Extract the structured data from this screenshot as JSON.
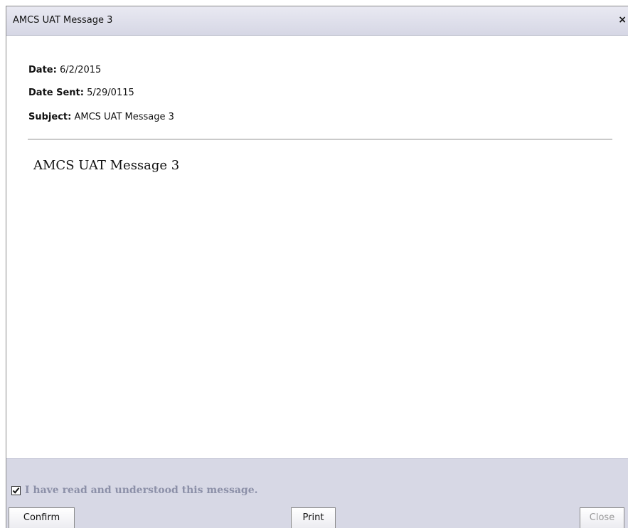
{
  "dialog": {
    "title": "AMCS UAT Message 3",
    "close_glyph": "×",
    "close_icon": "close-icon"
  },
  "message": {
    "date_label": "Date:",
    "date_value": "6/2/2015",
    "date_sent_label": "Date Sent:",
    "date_sent_value": "5/29/0115",
    "subject_label": "Subject:",
    "subject_value": "AMCS UAT Message 3",
    "body": "AMCS UAT Message 3"
  },
  "footer": {
    "acknowledge_label": "I have read and understood this message.",
    "acknowledge_checked": true,
    "confirm_label": "Confirm",
    "print_label": "Print",
    "close_label": "Close",
    "close_enabled": false
  },
  "colors": {
    "titlebar": "#d6d7e5",
    "footer": "#d7d8e5",
    "ack_text": "#8c90a8",
    "disabled_text": "#9a9a9a"
  }
}
